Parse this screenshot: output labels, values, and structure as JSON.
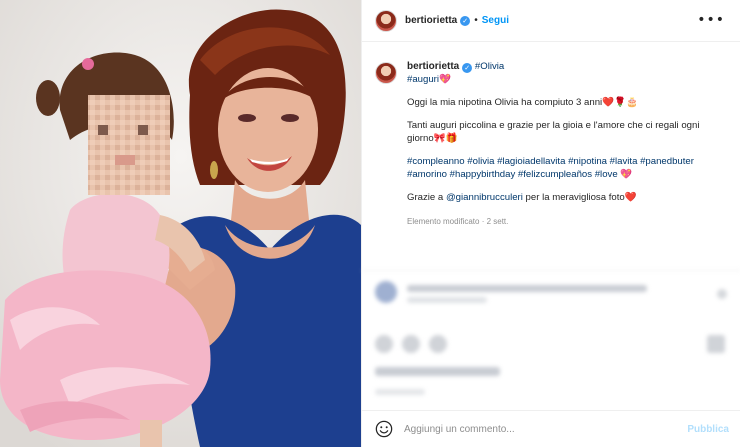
{
  "post": {
    "username": "bertiorietta",
    "verified_badge": "verified-icon",
    "separator": "•",
    "follow_label": "Segui",
    "more_icon": "more-options-icon",
    "more_glyph": "•••"
  },
  "caption": {
    "username": "bertiorietta",
    "tag_olivia": "#Olivia",
    "tag_auguri": "#auguri💖",
    "line1": "Oggi la mia nipotina Olivia ha compiuto 3 anni❤️🌹🎂",
    "line2": "Tanti auguri piccolina e grazie per la gioia e l'amore che ci regali ogni giorno🎀🎁",
    "hashtags": "#compleanno #olivia #lagioiadellavita #nipotina #lavita #panedbuter #amorino #happybirthday #felizcumpleaños #love 💖",
    "thanks_prefix": "Grazie a ",
    "thanks_mention": "@giannibrucculeri",
    "thanks_suffix": " per la meravigliosa foto❤️",
    "edited_meta": "Elemento modificato · 2 sett."
  },
  "comment_box": {
    "emoji_icon": "emoji-smiley-icon",
    "placeholder": "Aggiungi un commento...",
    "publish_label": "Pubblica"
  },
  "colors": {
    "link_blue": "#0095f6",
    "publish_disabled": "#b2dffc",
    "verified_blue": "#3897f0",
    "dress_pink": "#f4b6c8",
    "top_blue": "#1d3f8f"
  }
}
